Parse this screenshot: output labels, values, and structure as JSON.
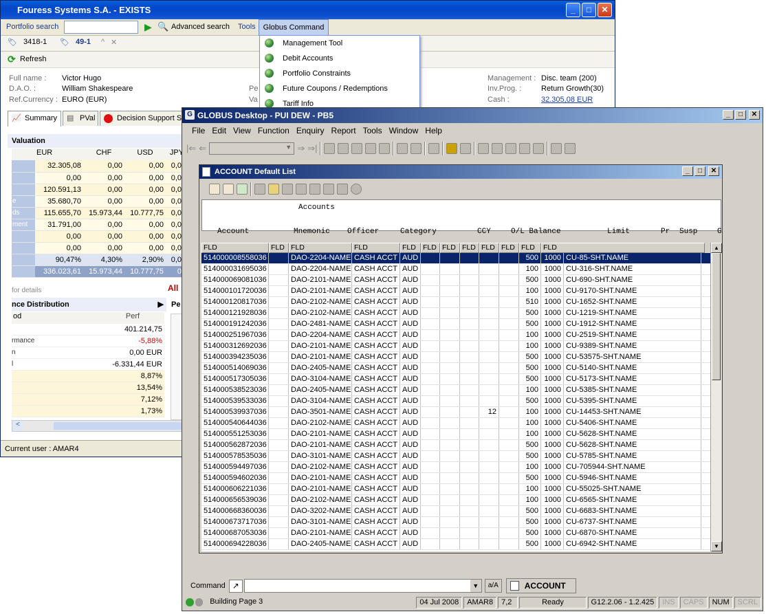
{
  "w1": {
    "title": "Fouress Systems S.A. - EXISTS",
    "search": {
      "portfolio_search": "Portfolio search",
      "advanced": "Advanced search",
      "tools": "Tools",
      "globus": "Globus Command"
    },
    "tabs": [
      "3418-1",
      "49-1"
    ],
    "refresh": "Refresh",
    "menu": [
      "Management Tool",
      "Debit Accounts",
      "Portfolio Constraints",
      "Future Coupons / Redemptions",
      "Tariff Info"
    ],
    "info": {
      "full_name_lbl": "Full name :",
      "full_name": "Victor Hugo",
      "dao_lbl": "D.A.O. :",
      "dao": "William Shakespeare",
      "refcur_lbl": "Ref.Currency :",
      "refcur": "EURO (EUR)",
      "pe": "Pe",
      "va": "Va",
      "mgmt_lbl": "Management :",
      "mgmt": "Disc. team (200)",
      "invprog_lbl": "Inv.Prog. :",
      "invprog": "Return Growth(30)",
      "cash_lbl": "Cash :",
      "cash": "32.305,08 EUR"
    },
    "subtabs": [
      "Summary",
      "PVal",
      "Decision Support S"
    ],
    "valuation": {
      "title": "Valuation",
      "cols": [
        "EUR",
        "CHF",
        "USD",
        "JPY"
      ],
      "side": [
        "",
        "",
        "",
        "e",
        "ds",
        "ment",
        "",
        "",
        ""
      ],
      "rows": [
        [
          "32.305,08",
          "0,00",
          "0,00",
          "0,0"
        ],
        [
          "0,00",
          "0,00",
          "0,00",
          "0,0"
        ],
        [
          "120.591,13",
          "0,00",
          "0,00",
          "0,0"
        ],
        [
          "35.680,70",
          "0,00",
          "0,00",
          "0,0"
        ],
        [
          "115.655,70",
          "15.973,44",
          "10.777,75",
          "0,0"
        ],
        [
          "31.791,00",
          "0,00",
          "0,00",
          "0,0"
        ],
        [
          "0,00",
          "0,00",
          "0,00",
          "0,0"
        ],
        [
          "0,00",
          "0,00",
          "0,00",
          "0,0"
        ],
        [
          "90,47%",
          "4,30%",
          "2,90%",
          "0,0"
        ],
        [
          "336.023,61",
          "15.973,44",
          "10.777,75",
          "0"
        ]
      ]
    },
    "for_details": "for details",
    "all": "All",
    "perf": {
      "title": "nce Distribution",
      "pe": "Pe",
      "col0": "od",
      "col1": "Perf",
      "labels": [
        "",
        "rmance",
        "n",
        "l",
        "",
        "",
        "",
        ""
      ],
      "values": [
        "401.214,75",
        "-5,88%",
        "0,00 EUR",
        "-6.331,44 EUR",
        "8,87%",
        "13,54%",
        "7,12%",
        "1,73%"
      ]
    },
    "status": "Current user : AMAR4"
  },
  "w2": {
    "title": "GLOBUS Desktop - PUI DEW - PB5",
    "menu": [
      "File",
      "Edit",
      "View",
      "Function",
      "Enquiry",
      "Report",
      "Tools",
      "Window",
      "Help"
    ],
    "inner_title": "ACCOUNT Default List",
    "hdr_title": "Accounts",
    "hdr_cols": [
      "Account",
      "Mnemonic",
      "Officer",
      "Category",
      "CCY",
      "O/L Balance",
      "Limit",
      "Pr",
      "Susp",
      "G"
    ],
    "grid_cols": [
      "FLD",
      "FLD",
      "FLD",
      "FLD",
      "FLD",
      "FLD",
      "FLD",
      "FLD",
      "FLD",
      "FLD",
      "FLD",
      "FLD"
    ],
    "rows": [
      [
        "514000008558036",
        "DAO-2204-NAME",
        "CASH ACCT",
        "AUD",
        "",
        "500",
        "1000",
        "CU-85-SHT.NAME"
      ],
      [
        "514000031695036",
        "DAO-2204-NAME",
        "CASH ACCT",
        "AUD",
        "",
        "100",
        "1000",
        "CU-316-SHT.NAME"
      ],
      [
        "514000069081036",
        "DAO-2101-NAME",
        "CASH ACCT",
        "AUD",
        "",
        "500",
        "1000",
        "CU-690-SHT.NAME"
      ],
      [
        "514000101720036",
        "DAO-2101-NAME",
        "CASH ACCT",
        "AUD",
        "",
        "100",
        "1000",
        "CU-9170-SHT.NAME"
      ],
      [
        "514000120817036",
        "DAO-2102-NAME",
        "CASH ACCT",
        "AUD",
        "",
        "510",
        "1000",
        "CU-1652-SHT.NAME"
      ],
      [
        "514000121928036",
        "DAO-2102-NAME",
        "CASH ACCT",
        "AUD",
        "",
        "500",
        "1000",
        "CU-1219-SHT.NAME"
      ],
      [
        "514000191242036",
        "DAO-2481-NAME",
        "CASH ACCT",
        "AUD",
        "",
        "500",
        "1000",
        "CU-1912-SHT.NAME"
      ],
      [
        "514000251967036",
        "DAO-2204-NAME",
        "CASH ACCT",
        "AUD",
        "",
        "100",
        "1000",
        "CU-2519-SHT.NAME"
      ],
      [
        "514000312692036",
        "DAO-2101-NAME",
        "CASH ACCT",
        "AUD",
        "",
        "100",
        "1000",
        "CU-9389-SHT.NAME"
      ],
      [
        "514000394235036",
        "DAO-2101-NAME",
        "CASH ACCT",
        "AUD",
        "",
        "500",
        "1000",
        "CU-53575-SHT.NAME"
      ],
      [
        "514000514069036",
        "DAO-2405-NAME",
        "CASH ACCT",
        "AUD",
        "",
        "500",
        "1000",
        "CU-5140-SHT.NAME"
      ],
      [
        "514000517305036",
        "DAO-3104-NAME",
        "CASH ACCT",
        "AUD",
        "",
        "500",
        "1000",
        "CU-5173-SHT.NAME"
      ],
      [
        "514000538523036",
        "DAO-2405-NAME",
        "CASH ACCT",
        "AUD",
        "",
        "100",
        "1000",
        "CU-5385-SHT.NAME"
      ],
      [
        "514000539533036",
        "DAO-3104-NAME",
        "CASH ACCT",
        "AUD",
        "",
        "500",
        "1000",
        "CU-5395-SHT.NAME"
      ],
      [
        "514000539937036",
        "DAO-3501-NAME",
        "CASH ACCT",
        "AUD",
        "12",
        "100",
        "1000",
        "CU-14453-SHT.NAME"
      ],
      [
        "514000540644036",
        "DAO-2102-NAME",
        "CASH ACCT",
        "AUD",
        "",
        "100",
        "1000",
        "CU-5406-SHT.NAME"
      ],
      [
        "514000551253036",
        "DAO-2101-NAME",
        "CASH ACCT",
        "AUD",
        "",
        "100",
        "1000",
        "CU-5628-SHT.NAME"
      ],
      [
        "514000562872036",
        "DAO-2101-NAME",
        "CASH ACCT",
        "AUD",
        "",
        "500",
        "1000",
        "CU-5628-SHT.NAME"
      ],
      [
        "514000578535036",
        "DAO-3101-NAME",
        "CASH ACCT",
        "AUD",
        "",
        "500",
        "1000",
        "CU-5785-SHT.NAME"
      ],
      [
        "514000594497036",
        "DAO-2102-NAME",
        "CASH ACCT",
        "AUD",
        "",
        "100",
        "1000",
        "CU-705944-SHT.NAME"
      ],
      [
        "514000594602036",
        "DAO-2101-NAME",
        "CASH ACCT",
        "AUD",
        "",
        "500",
        "1000",
        "CU-5946-SHT.NAME"
      ],
      [
        "514000606221036",
        "DAO-2101-NAME",
        "CASH ACCT",
        "AUD",
        "",
        "100",
        "1000",
        "CU-55025-SHT.NAME"
      ],
      [
        "514000656539036",
        "DAO-2102-NAME",
        "CASH ACCT",
        "AUD",
        "",
        "100",
        "1000",
        "CU-6565-SHT.NAME"
      ],
      [
        "514000668360036",
        "DAO-3202-NAME",
        "CASH ACCT",
        "AUD",
        "",
        "500",
        "1000",
        "CU-6683-SHT.NAME"
      ],
      [
        "514000673717036",
        "DAO-3101-NAME",
        "CASH ACCT",
        "AUD",
        "",
        "500",
        "1000",
        "CU-6737-SHT.NAME"
      ],
      [
        "514000687053036",
        "DAO-2101-NAME",
        "CASH ACCT",
        "AUD",
        "",
        "500",
        "1000",
        "CU-6870-SHT.NAME"
      ],
      [
        "514000694228036",
        "DAO-2405-NAME",
        "CASH ACCT",
        "AUD",
        "",
        "500",
        "1000",
        "CU-6942-SHT.NAME"
      ]
    ],
    "command_lbl": "Command",
    "case_btn": "a/A",
    "account_btn": "ACCOUNT",
    "status": {
      "building": "Building Page 3",
      "date": "04 Jul 2008",
      "user": "AMAR8",
      "num": "7,2",
      "ready": "Ready",
      "version": "G12.2.06 - 1.2.425",
      "ins": "INS",
      "caps": "CAPS",
      "numlk": "NUM",
      "scrl": "SCRL"
    }
  }
}
